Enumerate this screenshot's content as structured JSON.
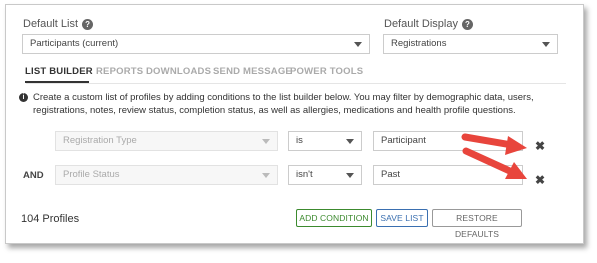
{
  "header": {
    "default_list_label": "Default List",
    "default_list_value": "Participants (current)",
    "default_display_label": "Default Display",
    "default_display_value": "Registrations"
  },
  "tabs": [
    "LIST BUILDER",
    "REPORTS",
    "DOWNLOADS",
    "SEND MESSAGE",
    "POWER TOOLS"
  ],
  "info_text": "Create a custom list of profiles by adding conditions to the list builder below. You may filter by demographic data, users, registrations, notes, review status, completion status, as well as allergies, medications and health profile questions.",
  "conditions": [
    {
      "conjunction": "",
      "field": "Registration Type",
      "operator": "is",
      "value": "Participant"
    },
    {
      "conjunction": "AND",
      "field": "Profile Status",
      "operator": "isn't",
      "value": "Past"
    }
  ],
  "profile_count": "104 Profiles",
  "buttons": {
    "add_condition": "ADD CONDITION",
    "save_list": "SAVE LIST",
    "restore_defaults": "RESTORE DEFAULTS"
  },
  "colors": {
    "arrow": "#e8453c",
    "add_button": "#3c8a2e",
    "save_button": "#3a6fb0"
  },
  "icons": {
    "help": "help-circle-icon",
    "info": "info-circle-icon",
    "remove": "close-x-icon"
  }
}
